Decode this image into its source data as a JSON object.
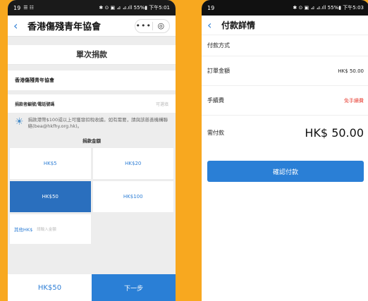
{
  "left": {
    "status": {
      "time": "19",
      "icons_left": "☰ ☷",
      "icons_right": "✱ ⊙ ▣ ⊿ ⊿.ıll 55%▮ 下午5:01"
    },
    "appbar": {
      "back_icon": "‹",
      "title": "香港傷殘青年協會",
      "more": "•••",
      "target_icon": "◎"
    },
    "section_title": "單次捐款",
    "org_name": "香港傷殘青年協會",
    "donor_field": {
      "label": "捐款者編號/電話號碼",
      "hint": "可選填"
    },
    "notice": "捐款港幣$100或以上可獲發扣稅收據。如有需要，請與該慈善機構聯絡(bea@hkfhy.org.hk)。",
    "amount_title": "捐款金額",
    "amounts": [
      {
        "label": "HK$5",
        "selected": false
      },
      {
        "label": "HK$20",
        "selected": false
      },
      {
        "label": "HK$50",
        "selected": true
      },
      {
        "label": "HK$100",
        "selected": false
      }
    ],
    "other": {
      "label": "其他HK$",
      "placeholder": "請輸入金額"
    },
    "bottom": {
      "amount": "HK$50",
      "next": "下一步"
    }
  },
  "right": {
    "status": {
      "time": "19",
      "icons_right": "✱ ⊙ ▣ ⊿ ⊿.ıll 55%▮ 下午5:03"
    },
    "header": {
      "back_icon": "‹",
      "title": "付款詳情"
    },
    "payment_method_label": "付款方式",
    "order_amount": {
      "label": "訂單金額",
      "value": "HK$ 50.00"
    },
    "fee": {
      "label": "手續費",
      "value": "免手續費"
    },
    "payable": {
      "label": "需付款",
      "value": "HK$ 50.00"
    },
    "confirm": "確認付款"
  }
}
